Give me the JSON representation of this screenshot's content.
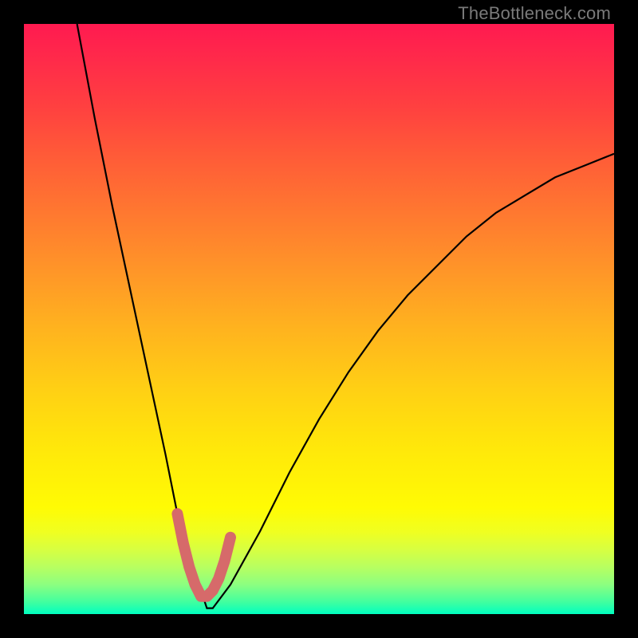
{
  "watermark": "TheBottleneck.com",
  "colors": {
    "frame": "#000000",
    "curve": "#000000",
    "marker": "#d66a6a"
  },
  "chart_data": {
    "type": "line",
    "title": "",
    "xlabel": "",
    "ylabel": "",
    "xlim": [
      0,
      100
    ],
    "ylim": [
      0,
      100
    ],
    "grid": false,
    "legend": false,
    "annotations": [
      "TheBottleneck.com"
    ],
    "series": [
      {
        "name": "bottleneck-curve",
        "x": [
          9,
          12,
          15,
          18,
          21,
          24,
          26,
          28,
          30,
          31,
          32,
          35,
          40,
          45,
          50,
          55,
          60,
          65,
          70,
          75,
          80,
          85,
          90,
          95,
          100
        ],
        "y": [
          100,
          84,
          69,
          55,
          41,
          27,
          17,
          10,
          4,
          1,
          1,
          5,
          14,
          24,
          33,
          41,
          48,
          54,
          59,
          64,
          68,
          71,
          74,
          76,
          78
        ]
      },
      {
        "name": "optimal-marker",
        "x": [
          26,
          27,
          28,
          29,
          30,
          31,
          32,
          33,
          34,
          35
        ],
        "y": [
          17,
          12,
          8,
          5,
          3,
          3,
          4,
          6,
          9,
          13
        ]
      }
    ]
  }
}
